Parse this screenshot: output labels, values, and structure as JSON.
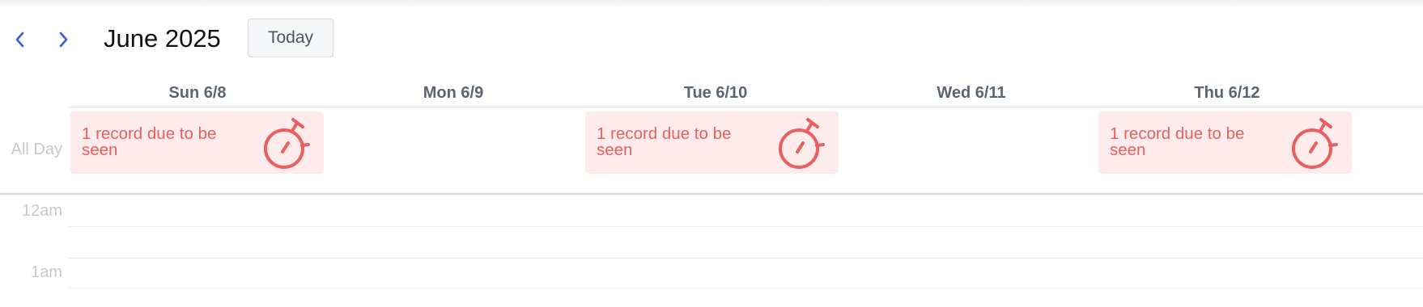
{
  "header": {
    "prev_icon": "chevron-left-icon",
    "next_icon": "chevron-right-icon",
    "month_title": "June 2025",
    "today_label": "Today",
    "accent_color": "#3b5bdb"
  },
  "days": [
    {
      "label": "Sun 6/8"
    },
    {
      "label": "Mon 6/9"
    },
    {
      "label": "Tue 6/10"
    },
    {
      "label": "Wed 6/11"
    },
    {
      "label": "Thu 6/12"
    }
  ],
  "all_day_label": "All Day",
  "events": [
    {
      "day": "Sun 6/8",
      "text": "1 record due to be seen",
      "icon": "stopwatch-icon"
    },
    {
      "day": "Tue 6/10",
      "text": "1 record due to be seen",
      "icon": "stopwatch-icon"
    },
    {
      "day": "Thu 6/12",
      "text": "1 record due to be seen",
      "icon": "stopwatch-icon"
    }
  ],
  "time_slots": [
    "12am",
    "1am"
  ],
  "colors": {
    "event_bg": "#fdeceb",
    "event_text": "#ea5f5f",
    "header_text": "#5b6675"
  }
}
